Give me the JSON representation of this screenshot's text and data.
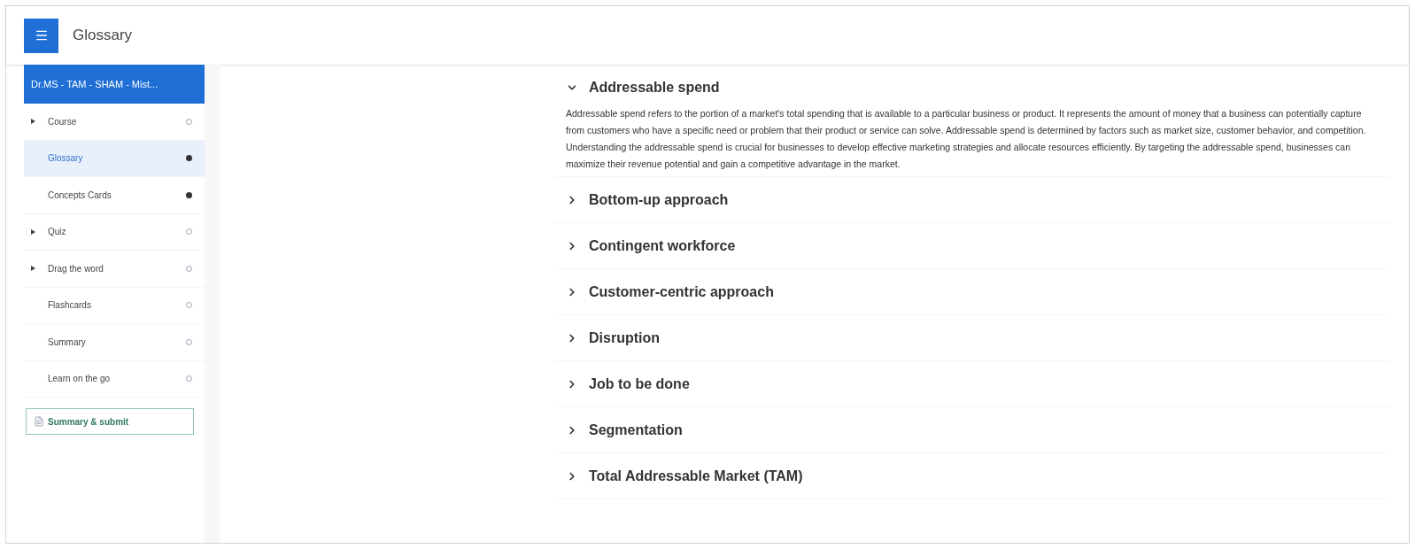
{
  "header": {
    "title": "Glossary"
  },
  "sidebar": {
    "course_title": "Dr.MS - TAM - SHAM - Mist...",
    "items": [
      {
        "label": "Course",
        "expandable": true,
        "selected": false,
        "done": false
      },
      {
        "label": "Glossary",
        "expandable": false,
        "selected": true,
        "done": true
      },
      {
        "label": "Concepts Cards",
        "expandable": false,
        "selected": false,
        "done": true
      },
      {
        "label": "Quiz",
        "expandable": true,
        "selected": false,
        "done": false
      },
      {
        "label": "Drag the word",
        "expandable": true,
        "selected": false,
        "done": false
      },
      {
        "label": "Flashcards",
        "expandable": false,
        "selected": false,
        "done": false
      },
      {
        "label": "Summary",
        "expandable": false,
        "selected": false,
        "done": false
      },
      {
        "label": "Learn on the go",
        "expandable": false,
        "selected": false,
        "done": false
      }
    ],
    "submit_button": "Summary & submit"
  },
  "glossary": [
    {
      "term": "Addressable spend",
      "expanded": true,
      "definition": "Addressable spend refers to the portion of a market's total spending that is available to a particular business or product. It represents the amount of money that a business can potentially capture from customers who have a specific need or problem that their product or service can solve. Addressable spend is determined by factors such as market size, customer behavior, and competition. Understanding the addressable spend is crucial for businesses to develop effective marketing strategies and allocate resources efficiently. By targeting the addressable spend, businesses can maximize their revenue potential and gain a competitive advantage in the market."
    },
    {
      "term": "Bottom-up approach",
      "expanded": false
    },
    {
      "term": "Contingent workforce",
      "expanded": false
    },
    {
      "term": "Customer-centric approach",
      "expanded": false
    },
    {
      "term": "Disruption",
      "expanded": false
    },
    {
      "term": "Job to be done",
      "expanded": false
    },
    {
      "term": "Segmentation",
      "expanded": false
    },
    {
      "term": "Total Addressable Market (TAM)",
      "expanded": false
    }
  ]
}
